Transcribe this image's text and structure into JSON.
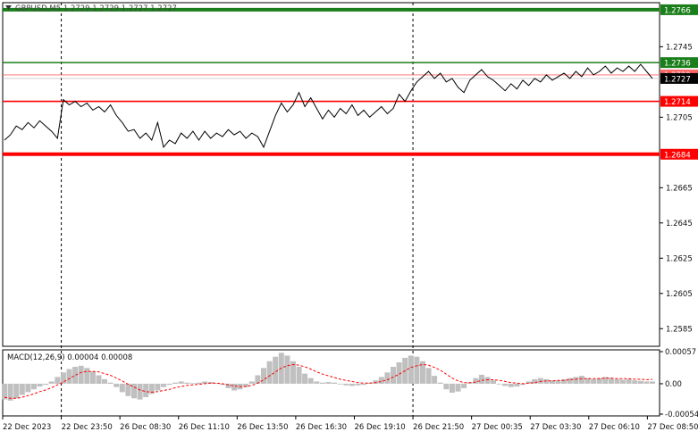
{
  "header": {
    "symbol_line": "GBPUSD,M5  1.2729 1.2729 1.2727 1.2727"
  },
  "colors": {
    "background": "#ffffff",
    "price_line": "#000000",
    "green_level": "#1a7f1a",
    "red_level": "#ff0000",
    "hist_bar": "#c0c0c0",
    "signal_line": "#ff0000",
    "current_price_box": "#000000",
    "bid_line": "#c0c0c0",
    "ask_line": "#ff6666"
  },
  "chart_data": [
    {
      "type": "line",
      "title": "",
      "series": [
        {
          "values": [
            1.2692,
            1.2695,
            1.27,
            1.2698,
            1.2702,
            1.2699,
            1.2703,
            1.27,
            1.2697,
            1.2693,
            1.2715,
            1.2712,
            1.2714,
            1.2711,
            1.2713,
            1.2709,
            1.2711,
            1.2708,
            1.2712,
            1.2706,
            1.2702,
            1.2697,
            1.2698,
            1.2693,
            1.2696,
            1.2692,
            1.2702,
            1.2688,
            1.2692,
            1.269,
            1.2696,
            1.2693,
            1.2697,
            1.2692,
            1.2697,
            1.2693,
            1.2696,
            1.2694,
            1.2698,
            1.2695,
            1.2697,
            1.2693,
            1.2696,
            1.2694,
            1.2688,
            1.2697,
            1.2706,
            1.2713,
            1.2708,
            1.2712,
            1.2719,
            1.2711,
            1.2716,
            1.271,
            1.2704,
            1.2709,
            1.2705,
            1.271,
            1.2707,
            1.2712,
            1.2706,
            1.2709,
            1.2705,
            1.2708,
            1.2711,
            1.2707,
            1.271,
            1.2718,
            1.2714,
            1.272,
            1.2725,
            1.2728,
            1.2731,
            1.2727,
            1.273,
            1.2725,
            1.2727,
            1.2722,
            1.2719,
            1.2726,
            1.2729,
            1.2732,
            1.2728,
            1.2726,
            1.2723,
            1.272,
            1.2724,
            1.2721,
            1.2726,
            1.2723,
            1.2727,
            1.2725,
            1.2729,
            1.2726,
            1.2728,
            1.273,
            1.2727,
            1.2731,
            1.2728,
            1.2733,
            1.2729,
            1.2731,
            1.2734,
            1.273,
            1.2733,
            1.2731,
            1.2734,
            1.2731,
            1.2735,
            1.2731,
            1.2727
          ],
          "color": "#000000"
        }
      ],
      "x_tick_labels": [
        "22 Dec 2023",
        "22 Dec 23:50",
        "26 Dec 08:30",
        "26 Dec 11:10",
        "26 Dec 13:50",
        "26 Dec 16:30",
        "26 Dec 19:10",
        "26 Dec 21:50",
        "27 Dec 00:35",
        "27 Dec 03:30",
        "27 Dec 06:10",
        "27 Dec 08:50"
      ],
      "y_ticks": [
        1.2585,
        1.2605,
        1.2625,
        1.2645,
        1.2665,
        1.2705,
        1.2745
      ],
      "ylim": [
        1.2575,
        1.277
      ],
      "levels": [
        {
          "value": 1.2766,
          "label": "1.2766",
          "kind": "green",
          "bold": true
        },
        {
          "value": 1.2736,
          "label": "1.2736",
          "kind": "green",
          "bold": false
        },
        {
          "value": 1.2714,
          "label": "1.2714",
          "kind": "red",
          "bold": false
        },
        {
          "value": 1.2684,
          "label": "1.2684",
          "kind": "red",
          "bold": true
        }
      ],
      "current_price": {
        "value": 1.2727,
        "label": "1.2727"
      },
      "ask_price": {
        "value": 1.2729,
        "label": "1.2729"
      },
      "vertical_separators": [
        1.0,
        7.0
      ]
    },
    {
      "type": "bar",
      "title": "MACD(12,26,9) 0.00004 0.00008",
      "series": [
        {
          "name": "MACD",
          "values": [
            -0.00028,
            -0.0003,
            -0.00026,
            -0.0002,
            -0.00015,
            -0.0001,
            -5e-05,
            -2e-05,
            4e-05,
            0.00012,
            0.0002,
            0.00026,
            0.0003,
            0.00032,
            0.00028,
            0.00022,
            0.00015,
            8e-05,
            2e-05,
            -6e-05,
            -0.00015,
            -0.00022,
            -0.00026,
            -0.00028,
            -0.00024,
            -0.00018,
            -0.00012,
            -6e-05,
            -2e-05,
            2e-05,
            4e-05,
            2e-05,
            1e-05,
            2e-05,
            4e-05,
            3e-05,
            1e-05,
            -2e-05,
            -8e-05,
            -0.00012,
            -0.0001,
            -6e-05,
            4e-05,
            0.00015,
            0.00028,
            0.0004,
            0.00048,
            0.00055,
            0.0005,
            0.0004,
            0.0003,
            0.00018,
            0.0001,
            4e-05,
            2e-05,
            3e-05,
            2e-05,
            -1e-05,
            -3e-05,
            -4e-05,
            -3e-05,
            -2e-05,
            2e-05,
            6e-05,
            0.00012,
            0.0002,
            0.0003,
            0.00038,
            0.00046,
            0.0005,
            0.00048,
            0.0004,
            0.00028,
            0.00014,
            2e-05,
            -0.0001,
            -0.00016,
            -0.00014,
            -8e-05,
            2e-05,
            0.0001,
            0.00016,
            0.00012,
            6e-05,
            0.0,
            -4e-05,
            -6e-05,
            -5e-05,
            -2e-05,
            4e-05,
            8e-05,
            0.0001,
            8e-05,
            6e-05,
            6e-05,
            8e-05,
            0.0001,
            0.00012,
            0.00014,
            0.0001,
            8e-05,
            0.0001,
            0.00012,
            0.0001,
            8e-05,
            7e-05,
            8e-05,
            6e-05,
            5e-05,
            4e-05,
            4e-05
          ]
        },
        {
          "name": "Signal",
          "values": [
            -0.00024,
            -0.00026,
            -0.00026,
            -0.00024,
            -0.00021,
            -0.00018,
            -0.00014,
            -0.00011,
            -7e-05,
            -2e-05,
            3e-05,
            9e-05,
            0.00015,
            0.0002,
            0.00022,
            0.00022,
            0.00021,
            0.00018,
            0.00015,
            0.0001,
            5e-05,
            -1e-05,
            -6e-05,
            -0.00011,
            -0.00014,
            -0.00015,
            -0.00014,
            -0.00012,
            -0.0001,
            -7e-05,
            -5e-05,
            -3e-05,
            -2e-05,
            -1e-05,
            0.0,
            1e-05,
            1e-05,
            0.0,
            -2e-05,
            -4e-05,
            -5e-05,
            -5e-05,
            -3e-05,
            1e-05,
            7e-05,
            0.00014,
            0.00021,
            0.00028,
            0.00032,
            0.00034,
            0.00033,
            0.0003,
            0.00026,
            0.00021,
            0.00017,
            0.00014,
            0.00011,
            8e-05,
            6e-05,
            4e-05,
            2e-05,
            1e-05,
            1e-05,
            2e-05,
            4e-05,
            7e-05,
            0.00012,
            0.00017,
            0.00023,
            0.00029,
            0.00032,
            0.00034,
            0.00033,
            0.00029,
            0.00024,
            0.00017,
            0.0001,
            5e-05,
            2e-05,
            2e-05,
            3e-05,
            6e-05,
            7e-05,
            7e-05,
            6e-05,
            4e-05,
            2e-05,
            1e-05,
            0.0,
            1e-05,
            2e-05,
            4e-05,
            5e-05,
            5e-05,
            6e-05,
            6e-05,
            7e-05,
            8e-05,
            9e-05,
            9e-05,
            9e-05,
            9e-05,
            0.0001,
            0.0001,
            9e-05,
            9e-05,
            9e-05,
            8e-05,
            8e-05,
            7e-05,
            8e-05
          ]
        }
      ],
      "y_tick_labels": [
        "0.00057",
        "0.00",
        "-0.00054"
      ],
      "ylim": [
        -0.00054,
        0.00057
      ]
    }
  ]
}
